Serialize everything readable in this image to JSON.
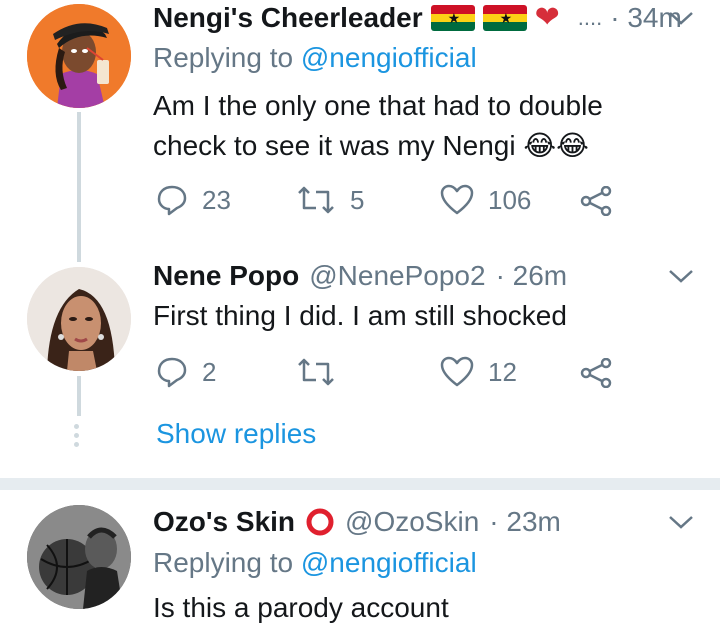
{
  "tweets": [
    {
      "name": "Nengi's Cheerleader",
      "handle": "....",
      "time": "· 34m",
      "replying_label": "Replying to",
      "replying_handle": "@nengiofficial",
      "text_line1": "Am I the only one that had to double",
      "text_line2": "check to see it was my Nengi",
      "emoji": "😂😂",
      "replies": "23",
      "retweets": "5",
      "likes": "106"
    },
    {
      "name": "Nene Popo",
      "handle": "@NenePopo2",
      "time": "· 26m",
      "text": "First thing I did. I am still shocked",
      "replies": "2",
      "retweets": "",
      "likes": "12"
    },
    {
      "name": "Ozo's Skin",
      "handle": "@OzoSkin",
      "time": "· 23m",
      "replying_label": "Replying to",
      "replying_handle": "@nengiofficial",
      "text": "Is this a parody account"
    }
  ],
  "show_replies": "Show replies",
  "colors": {
    "link": "#1b95e0",
    "muted": "#657786",
    "ghana_red": "#ce1126",
    "ghana_gold": "#fcd116",
    "ghana_green": "#006b3f"
  }
}
